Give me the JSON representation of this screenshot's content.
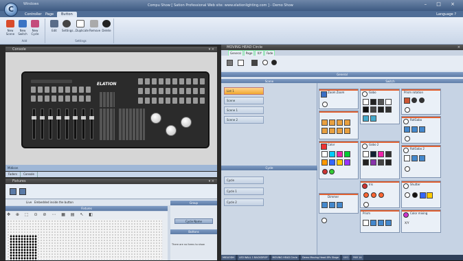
{
  "window": {
    "title": "Compu Show  [ Sation Professional  Web site: www.elationlighting.com ]  - Demo Show",
    "quick_access": "Windows",
    "language": "Language ?"
  },
  "menu_tabs": [
    {
      "label": "Controller"
    },
    {
      "label": "Page"
    },
    {
      "label": "Button"
    }
  ],
  "ribbon": {
    "new_group": {
      "buttons": [
        "New Scene",
        "New Switch",
        "New Cycle"
      ],
      "label": "Add"
    },
    "settings_group": {
      "buttons": [
        "Edit",
        "Settings...",
        "Duplicate",
        "Remove",
        "Delete"
      ],
      "label": "Settings"
    }
  },
  "console_panel": {
    "title": "Console",
    "logo": "ELATION",
    "status": "Midicon",
    "tabs": [
      "Faders",
      "Console"
    ]
  },
  "lower_panel": {
    "title": "Fixtures",
    "tab_label": "Live",
    "tab_label2": "Embedded inside the button",
    "fixtures_label": "Fixtures",
    "group_label": "Group",
    "cue_name": "Cycle Name",
    "buttons_label": "Buttons",
    "note": "There are no items to show"
  },
  "moving_head": {
    "title": "MOVING HEAD Circle",
    "tabs": [
      "General",
      "Page",
      "X/Y",
      "Fade"
    ],
    "general_label": "General",
    "scene_header": "Scene",
    "switch_header": "Switch",
    "cycle_header": "Cycle",
    "scenes": [
      "List 1",
      "Scene",
      "Scene 1",
      "Scene 2"
    ],
    "cycles": [
      "Cycle",
      "Cycle 1",
      "Cycle 2"
    ],
    "switch_boxes": [
      "Zoom Zoom",
      "Gobo",
      "Prism rotation",
      "Color",
      "Gobo 2",
      "RotGobo",
      "RotGobo 2",
      "Iris",
      "Shutter",
      "Dimmer",
      "Prism",
      "Color mixing"
    ],
    "xy_label": "X/Y"
  },
  "taskbar": [
    "MIDI/ODH",
    "LED WALL 1 BACKDROP",
    "MOVING HEAD Circle",
    "Demo Moving Head 8Pc Stage",
    "UV1",
    "PAR 1A"
  ],
  "colors": {
    "accent": "#e06030",
    "titlebar": "#3d5a82",
    "panel_bg": "#d9e2ee"
  }
}
